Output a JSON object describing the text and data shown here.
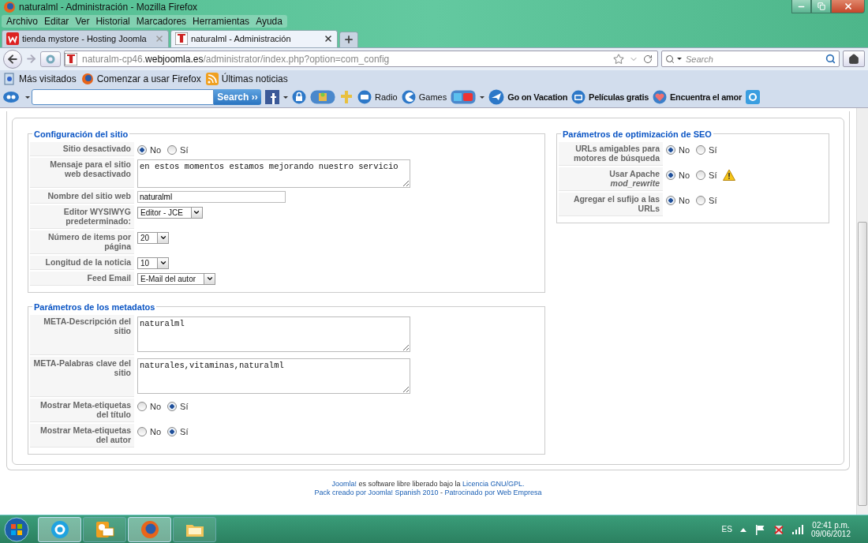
{
  "window": {
    "title": "naturalml - Administración - Mozilla Firefox"
  },
  "menu": [
    "Archivo",
    "Editar",
    "Ver",
    "Historial",
    "Marcadores",
    "Herramientas",
    "Ayuda"
  ],
  "tabs": [
    {
      "label": "tienda mystore - Hosting Joomla",
      "selected": false,
      "kind": "store"
    },
    {
      "label": "naturalml - Administración",
      "selected": true,
      "kind": "joomla"
    }
  ],
  "address": {
    "prefix": "naturalm-cp46.",
    "host": "webjoomla.es",
    "path": "/administrator/index.php?option=com_config"
  },
  "search": {
    "placeholder": "Search"
  },
  "bookmarks": [
    {
      "label": "Más visitados",
      "kind": "page"
    },
    {
      "label": "Comenzar a usar Firefox",
      "kind": "firefox"
    },
    {
      "label": "Últimas noticias",
      "kind": "feed"
    }
  ],
  "toolbar": {
    "button": "Search ››",
    "items": [
      {
        "label": "Radio",
        "kind": "radio"
      },
      {
        "label": "Games",
        "kind": "games"
      },
      {
        "label": "Go on Vacation",
        "kind": "vacation"
      },
      {
        "label": "Películas gratis",
        "kind": "movies"
      },
      {
        "label": "Encuentra el amor",
        "kind": "love"
      }
    ]
  },
  "left_fieldsets": [
    {
      "title": "Configuración del sitio",
      "rows": [
        {
          "label": "Sitio desactivado",
          "kind": "radio",
          "options": [
            {
              "label": "No",
              "selected": true
            },
            {
              "label": "Sí",
              "selected": false
            }
          ]
        },
        {
          "label": "Mensaje para el sitio web desactivado",
          "kind": "textarea",
          "value": "en estos momentos estamos mejorando nuestro servicio"
        },
        {
          "label": "Nombre del sitio web",
          "kind": "text",
          "value": "naturalml"
        },
        {
          "label": "Editor WYSIWYG predeterminado:",
          "kind": "select",
          "value": "Editor - JCE"
        },
        {
          "label": "Número de items por página",
          "kind": "select",
          "value": "20"
        },
        {
          "label": "Longitud de la noticia",
          "kind": "select",
          "value": "10"
        },
        {
          "label": "Feed Email",
          "kind": "select",
          "value": "E-Mail del autor"
        }
      ]
    },
    {
      "title": "Parámetros de los metadatos",
      "rows": [
        {
          "label": "META-Descripción del sitio",
          "kind": "textarea",
          "value": "naturalml"
        },
        {
          "label": "META-Palabras clave del sitio",
          "kind": "textarea",
          "value": "naturales,vitaminas,naturalml"
        },
        {
          "label": "Mostrar Meta-etiquetas del título",
          "kind": "radio",
          "options": [
            {
              "label": "No",
              "selected": false
            },
            {
              "label": "Sí",
              "selected": true
            }
          ]
        },
        {
          "label": "Mostrar Meta-etiquetas del autor",
          "kind": "radio",
          "options": [
            {
              "label": "No",
              "selected": false
            },
            {
              "label": "Sí",
              "selected": true
            }
          ]
        }
      ]
    }
  ],
  "right_fieldsets": [
    {
      "title": "Parámetros de optimización de SEO",
      "rows": [
        {
          "label": "URLs amigables para motores de búsqueda",
          "kind": "radio",
          "warning": false,
          "options": [
            {
              "label": "No",
              "selected": true
            },
            {
              "label": "Sí",
              "selected": false
            }
          ]
        },
        {
          "label": "Usar Apache *mod_rewrite*",
          "kind": "radio",
          "warning": true,
          "options": [
            {
              "label": "No",
              "selected": true
            },
            {
              "label": "Sí",
              "selected": false
            }
          ]
        },
        {
          "label": "Agregar el sufijo a las URLs",
          "kind": "radio",
          "warning": false,
          "options": [
            {
              "label": "No",
              "selected": true
            },
            {
              "label": "Sí",
              "selected": false
            }
          ]
        }
      ]
    }
  ],
  "footer": [
    [
      {
        "text": "Joomla!",
        "link": true
      },
      {
        "text": " es software libre liberado bajo la ",
        "link": false
      },
      {
        "text": "Licencia GNU/GPL.",
        "link": true
      }
    ],
    [
      {
        "text": "Pack creado por Joomla! Spanish 2010",
        "link": true
      },
      {
        "text": " - ",
        "link": false
      },
      {
        "text": "Patrocinado por Web Empresa",
        "link": true
      }
    ]
  ],
  "taskbar": {
    "language": "ES",
    "time": "02:41 p.m.",
    "date": "09/06/2012",
    "apps": [
      {
        "kind": "skype",
        "selected": true
      },
      {
        "kind": "outlook",
        "selected": false
      },
      {
        "kind": "firefox",
        "selected": true
      },
      {
        "kind": "folder",
        "selected": false
      }
    ]
  }
}
